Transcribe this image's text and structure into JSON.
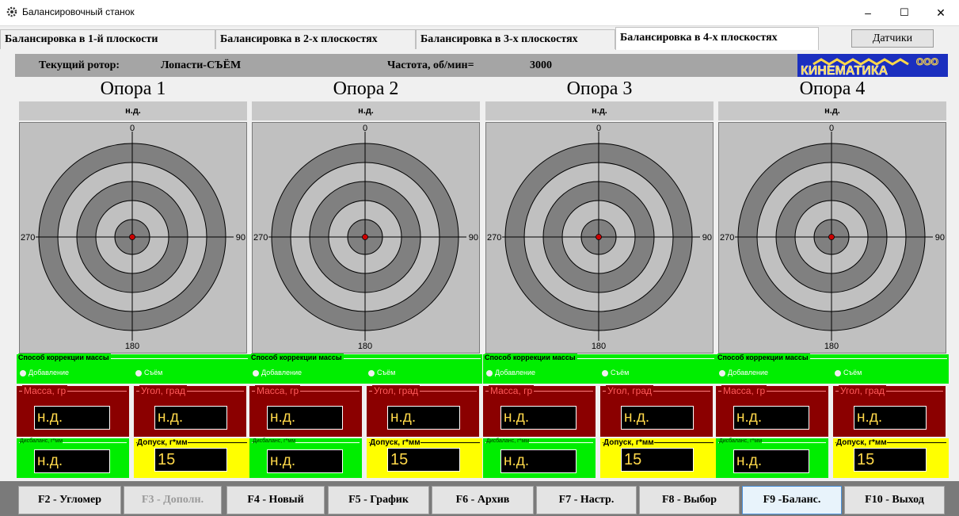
{
  "window": {
    "title": "Балансировочный станок",
    "minimize": "–",
    "maximize": "☐",
    "close": "✕"
  },
  "tabs": [
    {
      "label": "Балансировка в 1-й плоскости",
      "active": false
    },
    {
      "label": "Балансировка в 2-х плоскостях",
      "active": false
    },
    {
      "label": "Балансировка в 3-х плоскостях",
      "active": false
    },
    {
      "label": "Балансировка в 4-х плоскостях",
      "active": true
    }
  ],
  "sensors_button": "Датчики",
  "info": {
    "rotor_label": "Текущий ротор:",
    "rotor_value": "Лопасти-СЪЁМ",
    "freq_label": "Частота, об/мин=",
    "freq_value": "3000"
  },
  "logo": {
    "text": "КИНЕМАТИКА",
    "suffix": "ООО"
  },
  "colors": {
    "correction_bg": "#00ee00",
    "mass_bg": "#8b0000",
    "tolerance_bg": "#ffff00",
    "display_text": "#ffd84a",
    "target_ring_dark": "#808080",
    "target_ring_light": "#c0c0c0",
    "center_dot": "#cc0000"
  },
  "supports": [
    {
      "title": "Опора 1",
      "status": "н.д.",
      "axis": {
        "top": "0",
        "right": "90",
        "bottom": "180",
        "left": "270"
      },
      "correction": {
        "label": "Способ коррекции массы",
        "add": "Добавление",
        "remove": "Съём"
      },
      "mass": {
        "label": "Масса, гр",
        "value": "н.д."
      },
      "angle": {
        "label": "Угол, град",
        "value": "н.д."
      },
      "imbalance": {
        "label": "Дисбаланс, г*мм",
        "value": "н.д."
      },
      "tolerance": {
        "label": "Допуск, г*мм",
        "value": "15"
      }
    },
    {
      "title": "Опора 2",
      "status": "н.д.",
      "axis": {
        "top": "0",
        "right": "90",
        "bottom": "180",
        "left": "270"
      },
      "correction": {
        "label": "Способ коррекции массы",
        "add": "Добавление",
        "remove": "Съём"
      },
      "mass": {
        "label": "Масса, гр",
        "value": "н.д."
      },
      "angle": {
        "label": "Угол, град",
        "value": "н.д."
      },
      "imbalance": {
        "label": "Дисбаланс, г*мм",
        "value": "н.д."
      },
      "tolerance": {
        "label": "Допуск, г*мм",
        "value": "15"
      }
    },
    {
      "title": "Опора 3",
      "status": "н.д.",
      "axis": {
        "top": "0",
        "right": "90",
        "bottom": "180",
        "left": "270"
      },
      "correction": {
        "label": "Способ коррекции массы",
        "add": "Добавление",
        "remove": "Съём"
      },
      "mass": {
        "label": "Масса, гр",
        "value": "н.д."
      },
      "angle": {
        "label": "Угол, град",
        "value": "н.д."
      },
      "imbalance": {
        "label": "Дисбаланс, г*мм",
        "value": "н.д."
      },
      "tolerance": {
        "label": "Допуск, г*мм",
        "value": "15"
      }
    },
    {
      "title": "Опора 4",
      "status": "н.д.",
      "axis": {
        "top": "0",
        "right": "90",
        "bottom": "180",
        "left": "270"
      },
      "correction": {
        "label": "Способ коррекции массы",
        "add": "Добавление",
        "remove": "Съём"
      },
      "mass": {
        "label": "Масса, гр",
        "value": "н.д."
      },
      "angle": {
        "label": "Угол, град",
        "value": "н.д."
      },
      "imbalance": {
        "label": "Дисбаланс, г*мм",
        "value": "н.д."
      },
      "tolerance": {
        "label": "Допуск, г*мм",
        "value": "15"
      }
    }
  ],
  "function_keys": [
    {
      "label": "F2 - Угломер",
      "state": "normal"
    },
    {
      "label": "F3 - Дополн.",
      "state": "disabled"
    },
    {
      "label": "F4 - Новый",
      "state": "normal"
    },
    {
      "label": "F5 - График",
      "state": "normal"
    },
    {
      "label": "F6 - Архив",
      "state": "normal"
    },
    {
      "label": "F7 - Настр.",
      "state": "normal"
    },
    {
      "label": "F8 - Выбор",
      "state": "normal"
    },
    {
      "label": "F9 -Баланс.",
      "state": "active"
    },
    {
      "label": "F10 - Выход",
      "state": "normal"
    }
  ]
}
